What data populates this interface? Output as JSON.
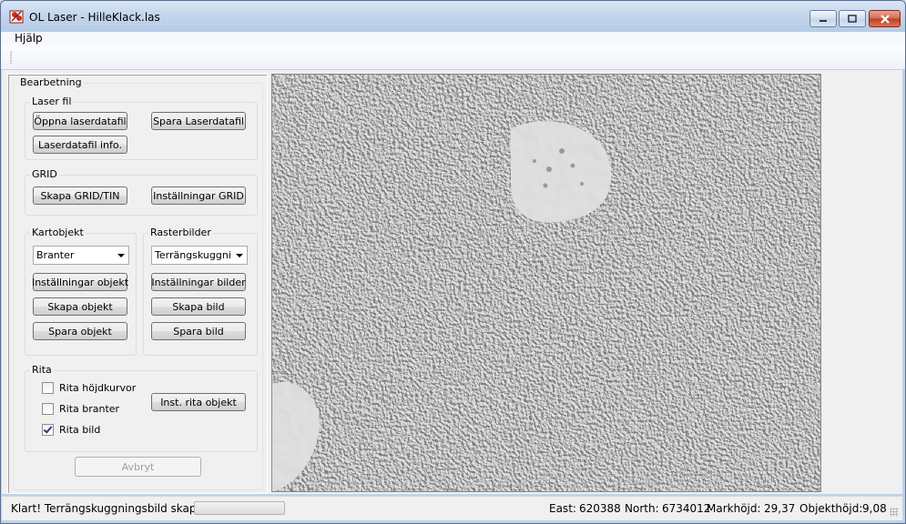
{
  "window": {
    "title": "OL Laser - HilleKlack.las",
    "controls": [
      "minimize-icon",
      "maximize-icon",
      "close-icon"
    ]
  },
  "menu": {
    "items": [
      "Hjälp"
    ]
  },
  "panel": {
    "title": "Bearbetning",
    "laser": {
      "label": "Laser fil",
      "open": "Öppna laserdatafil",
      "save": "Spara Laserdatafil",
      "info": "Laserdatafil info."
    },
    "grid": {
      "label": "GRID",
      "create": "Skapa GRID/TIN",
      "settings": "Inställningar GRID"
    },
    "kartobjekt": {
      "label": "Kartobjekt",
      "selected": "Branter",
      "settings": "Inställningar objekt",
      "create": "Skapa objekt",
      "save": "Spara objekt"
    },
    "raster": {
      "label": "Rasterbilder",
      "selected": "Terrängskuggning",
      "settings": "Inställningar bilder",
      "create": "Skapa bild",
      "save": "Spara bild"
    },
    "rita": {
      "label": "Rita",
      "hojdkurvor": "Rita höjdkurvor",
      "hojdkurvor_checked": false,
      "branter": "Rita branter",
      "branter_checked": false,
      "bild": "Rita bild",
      "bild_checked": true,
      "inst": "Inst. rita objekt"
    },
    "cancel": "Avbryt"
  },
  "status": {
    "message": "Klart! Terrängskuggningsbild skapad.",
    "progress": 0,
    "east_label": "East:",
    "east": "620388",
    "north_label": "North:",
    "north": "6734012",
    "markhojd_label": "Markhöjd:",
    "markhojd": "29,37",
    "objekthojd_label": "Objekthöjd:",
    "objekthojd": "9,08"
  },
  "colors": {
    "titlebar": "#c4d6ed",
    "client": "#f0f0f0",
    "hillshade": "#9a9a9a",
    "close": "#c13b1f"
  }
}
